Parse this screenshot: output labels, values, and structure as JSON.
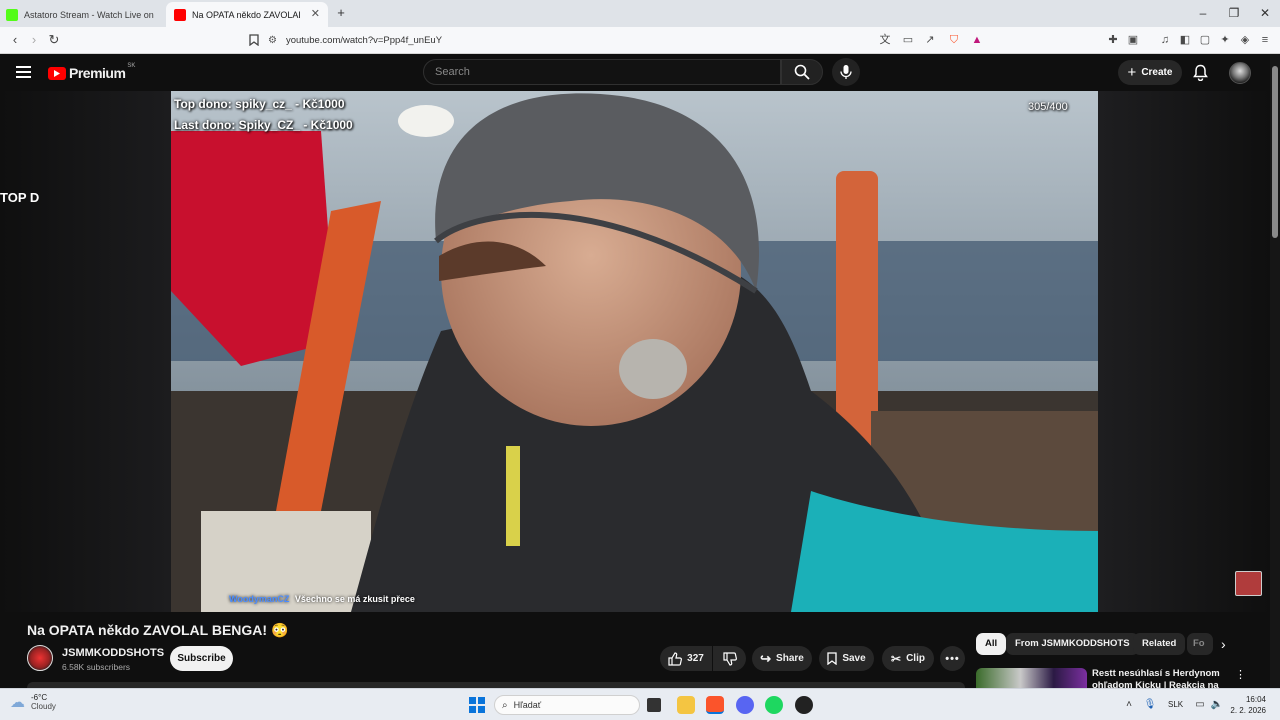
{
  "browser": {
    "tabs": [
      {
        "title": "Astatoro Stream - Watch Live on"
      },
      {
        "title": "Na OPATA někdo ZAVOLAL BENGA!"
      }
    ],
    "url": "youtube.com/watch?v=Ppp4f_unEuY"
  },
  "youtube": {
    "logo_text": "Premium",
    "region": "SK",
    "search_placeholder": "Search",
    "create_label": "Create"
  },
  "video": {
    "overlay_top_dono": "Top dono: spiky_cz_ - Kč1000",
    "overlay_last_dono": "Last dono: Spiky_CZ_ - Kč1000",
    "counter": "305/400",
    "chat_user": "WoodymanCZ",
    "chat_message": "Všechno se má zkusit přece",
    "left_overlay_text": "TOP D"
  },
  "watch": {
    "title": "Na OPATA někdo ZAVOLAL BENGA! 😳",
    "channel_name": "JSMMKODDSHOTS",
    "subscribers": "6.58K subscribers",
    "subscribe_label": "Subscribe",
    "likes": "327",
    "share_label": "Share",
    "save_label": "Save",
    "clip_label": "Clip"
  },
  "sidebar": {
    "chips": [
      "All",
      "From JSMMKODDSHOTS",
      "Related",
      "Fo"
    ],
    "rec_title_line1": "Restt nesúhlasí s Herdynom",
    "rec_title_line2": "ohľadom Kicku | Reakcia na"
  },
  "taskbar": {
    "weather_temp": "-6°C",
    "weather_desc": "Cloudy",
    "search_placeholder": "Hľadať",
    "language": "SLK",
    "time": "16:04",
    "date": "2. 2. 2026"
  },
  "colors": {
    "youtube_red": "#ff0000",
    "page_bg": "#0f0f0f",
    "chip_bg": "#272727"
  }
}
